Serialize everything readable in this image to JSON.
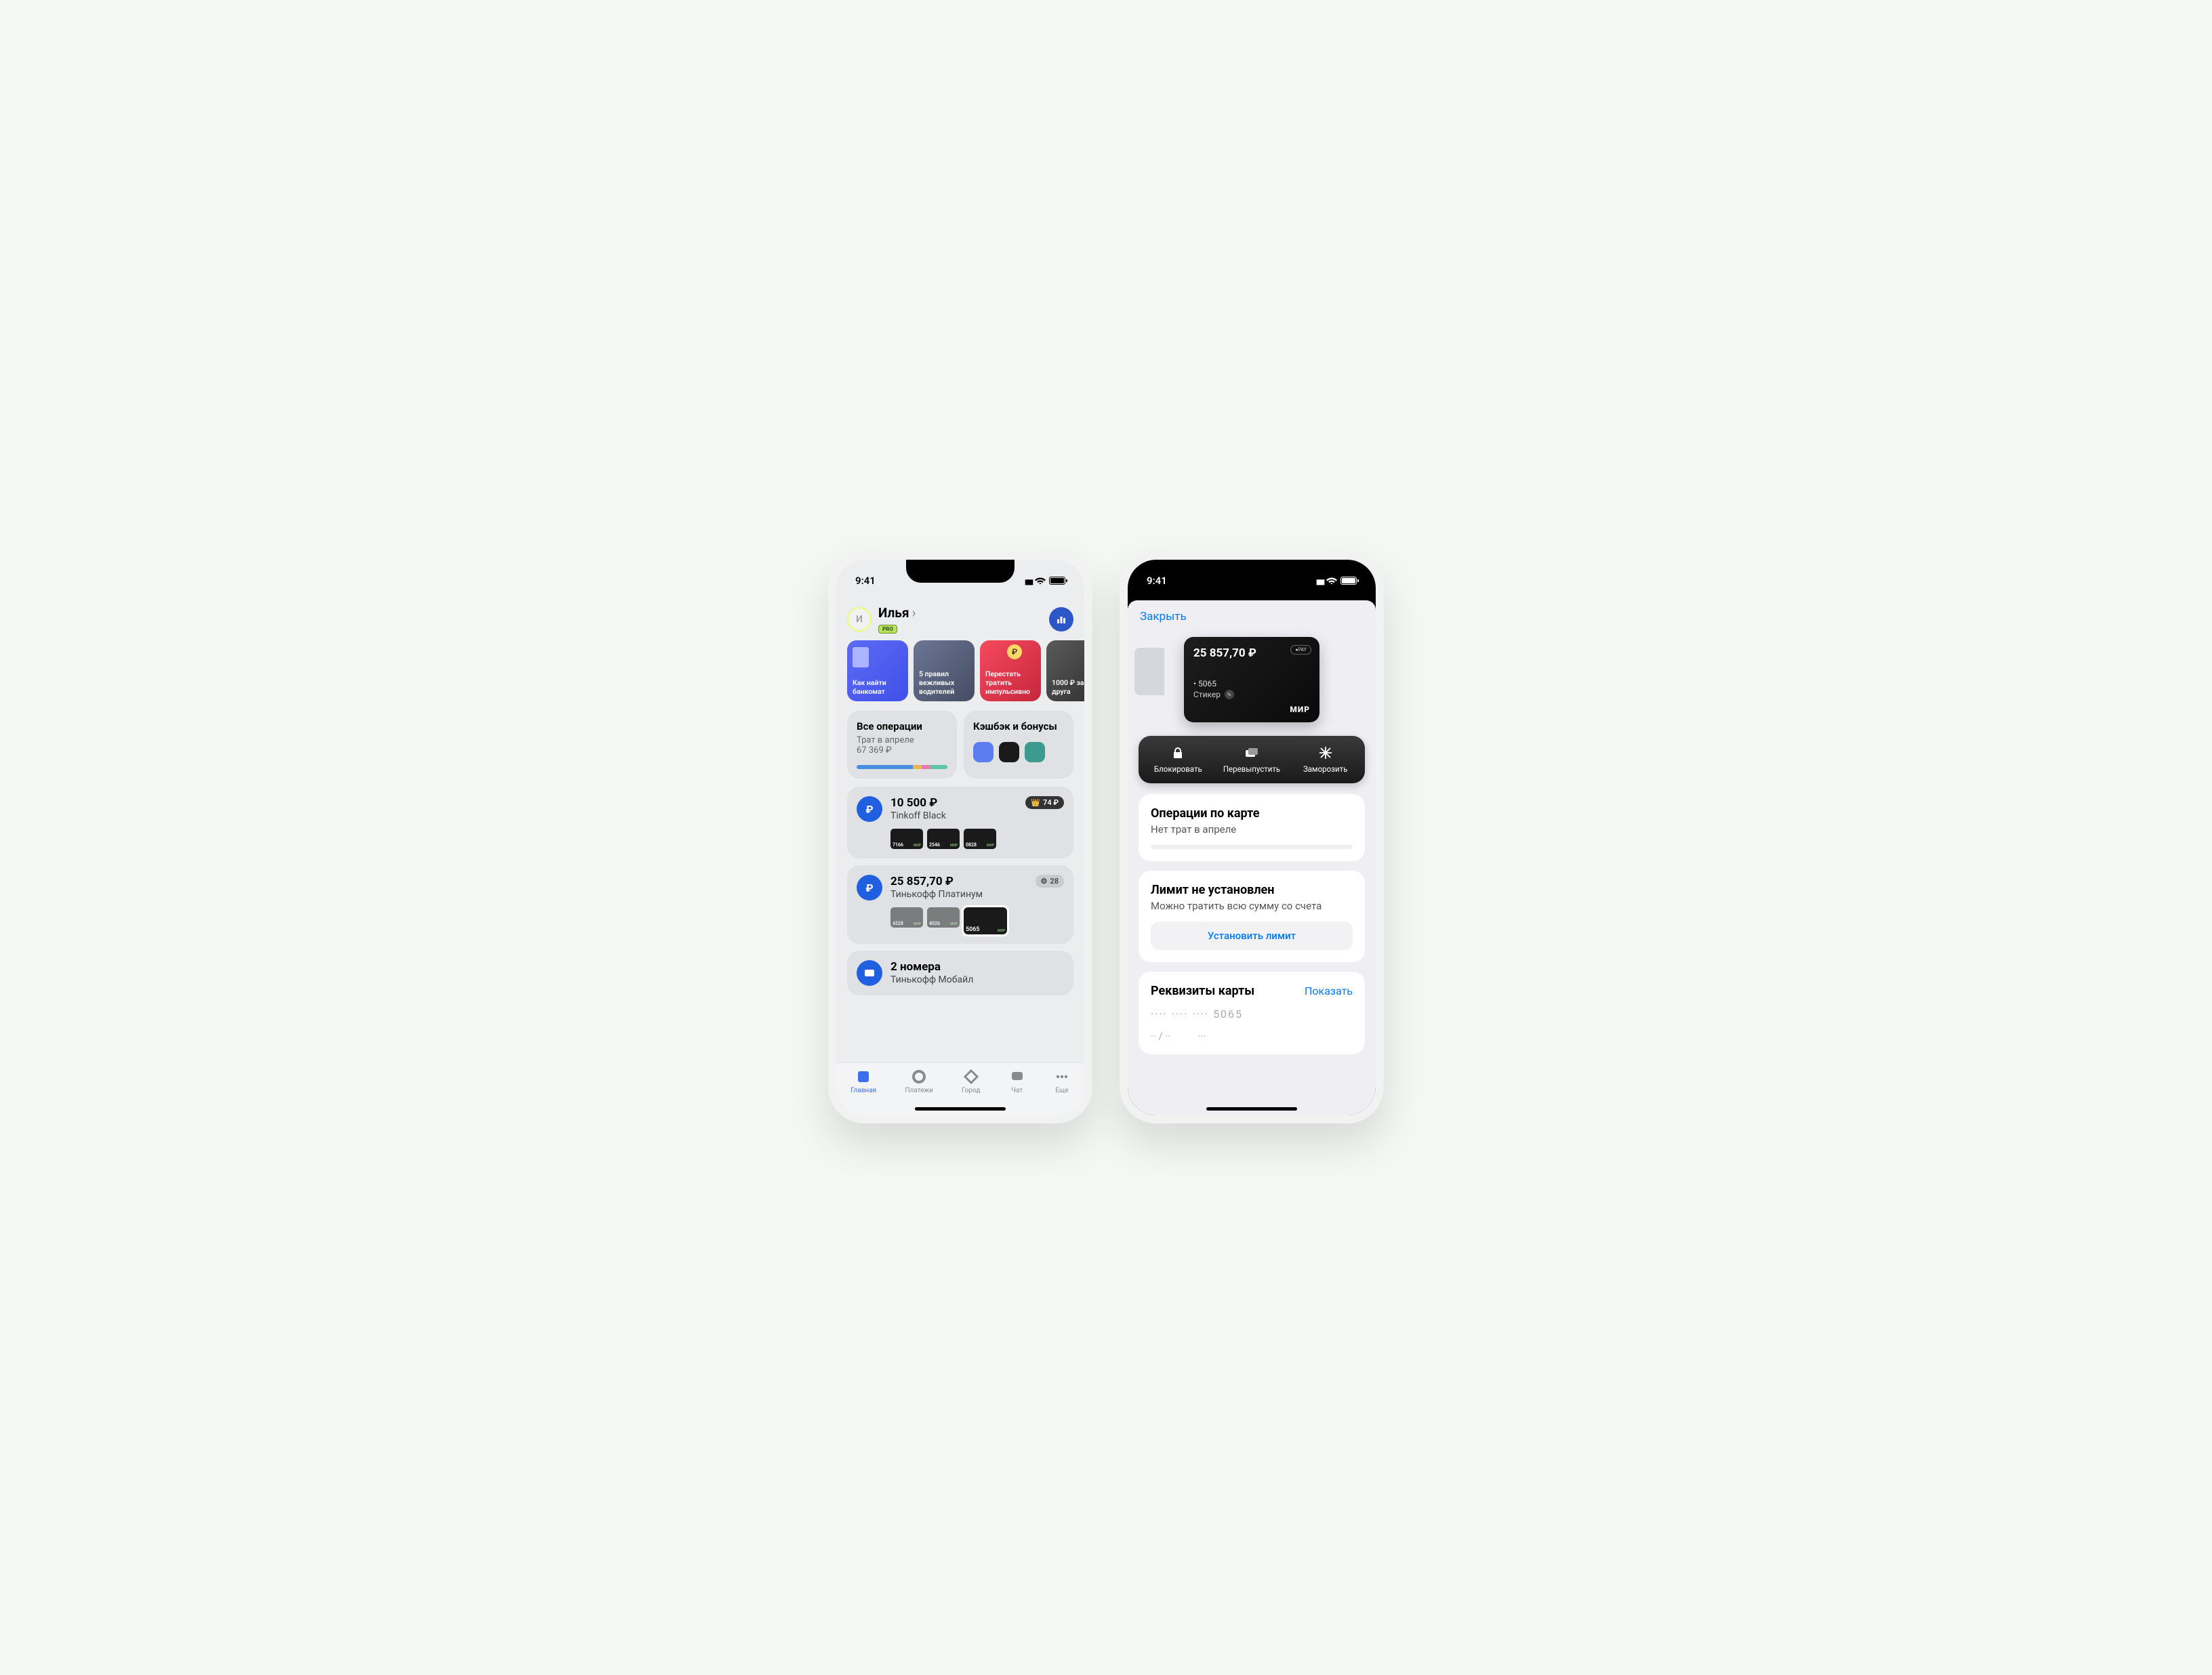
{
  "status": {
    "time": "9:41"
  },
  "phone1": {
    "user": {
      "initial": "И",
      "name": "Илья",
      "badge": "PRO"
    },
    "stories": [
      {
        "text": "Как найти банкомат"
      },
      {
        "text": "5 правил вежливых водителей"
      },
      {
        "text": "Перестать тратить импульсивно"
      },
      {
        "text": "1000 ₽ за друга"
      }
    ],
    "widgets": {
      "spend": {
        "title": "Все операции",
        "sub1": "Трат в апреле",
        "sub2": "67 369 ₽"
      },
      "cashback": {
        "title": "Кэшбэк и бонусы"
      }
    },
    "accounts": [
      {
        "balance": "10 500 ₽",
        "name": "Tinkoff Black",
        "badge": "74 ₽",
        "badge_icon": "👑",
        "cards": [
          {
            "num": "7166"
          },
          {
            "num": "2546"
          },
          {
            "num": "0828"
          }
        ]
      },
      {
        "balance": "25 857,70 ₽",
        "name": "Тинькофф Платинум",
        "badge": "28",
        "badge_icon": "⚙",
        "cards": [
          {
            "num": "4328",
            "faded": true
          },
          {
            "num": "4026",
            "faded": true
          },
          {
            "num": "5065",
            "selected": true
          }
        ]
      },
      {
        "balance": "2 номера",
        "name": "Тинькофф Мобайл"
      }
    ],
    "tabs": [
      {
        "label": "Главная"
      },
      {
        "label": "Платежи"
      },
      {
        "label": "Город"
      },
      {
        "label": "Чат"
      },
      {
        "label": "Еще"
      }
    ]
  },
  "phone2": {
    "close": "Закрыть",
    "card": {
      "balance": "25 857,70 ₽",
      "pay": "●PAY",
      "number": "• 5065",
      "name": "Стикер",
      "mir": "МИР"
    },
    "actions": [
      {
        "label": "Блокировать"
      },
      {
        "label": "Перевыпустить"
      },
      {
        "label": "Заморозить"
      }
    ],
    "ops": {
      "title": "Операции по карте",
      "sub": "Нет трат в апреле"
    },
    "limit": {
      "title": "Лимит не установлен",
      "sub": "Можно тратить всю сумму со счета",
      "btn": "Установить лимит"
    },
    "req": {
      "title": "Реквизиты карты",
      "show": "Показать",
      "masked_num": "···· ···· ···· 5065",
      "exp": "·· / ··",
      "cvv": "···"
    }
  }
}
